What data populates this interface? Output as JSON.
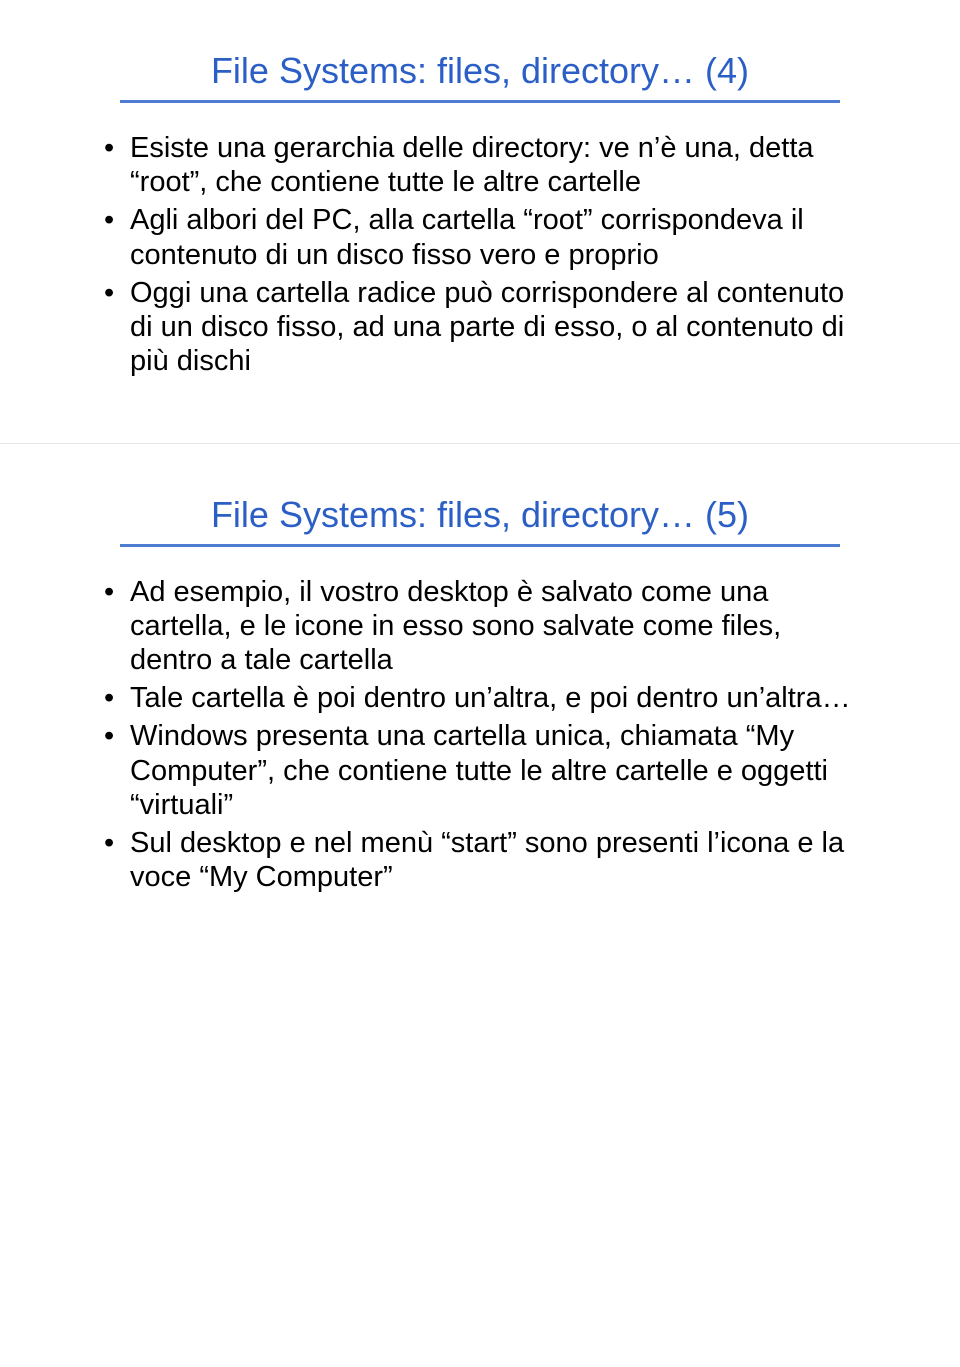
{
  "slides": [
    {
      "title": "File Systems: files, directory… (4)",
      "bullets": [
        "Esiste una gerarchia delle directory: ve n’è una, detta “root”, che contiene tutte le altre cartelle",
        "Agli albori del PC, alla cartella “root” corrispondeva il contenuto di un disco fisso vero e proprio",
        "Oggi una cartella radice può corrispondere al contenuto di un disco fisso, ad una parte di esso, o al contenuto di più dischi"
      ]
    },
    {
      "title": "File Systems: files, directory… (5)",
      "bullets": [
        "Ad esempio, il vostro desktop è salvato come una cartella, e le icone in esso sono salvate come files, dentro a tale cartella",
        "Tale cartella è poi dentro un’altra, e poi dentro un’altra…",
        "Windows presenta una cartella unica, chiamata “My Computer”, che contiene tutte le altre cartelle e oggetti “virtuali”",
        "Sul desktop e nel menù “start” sono presenti l’icona e la voce “My Computer”"
      ]
    }
  ]
}
